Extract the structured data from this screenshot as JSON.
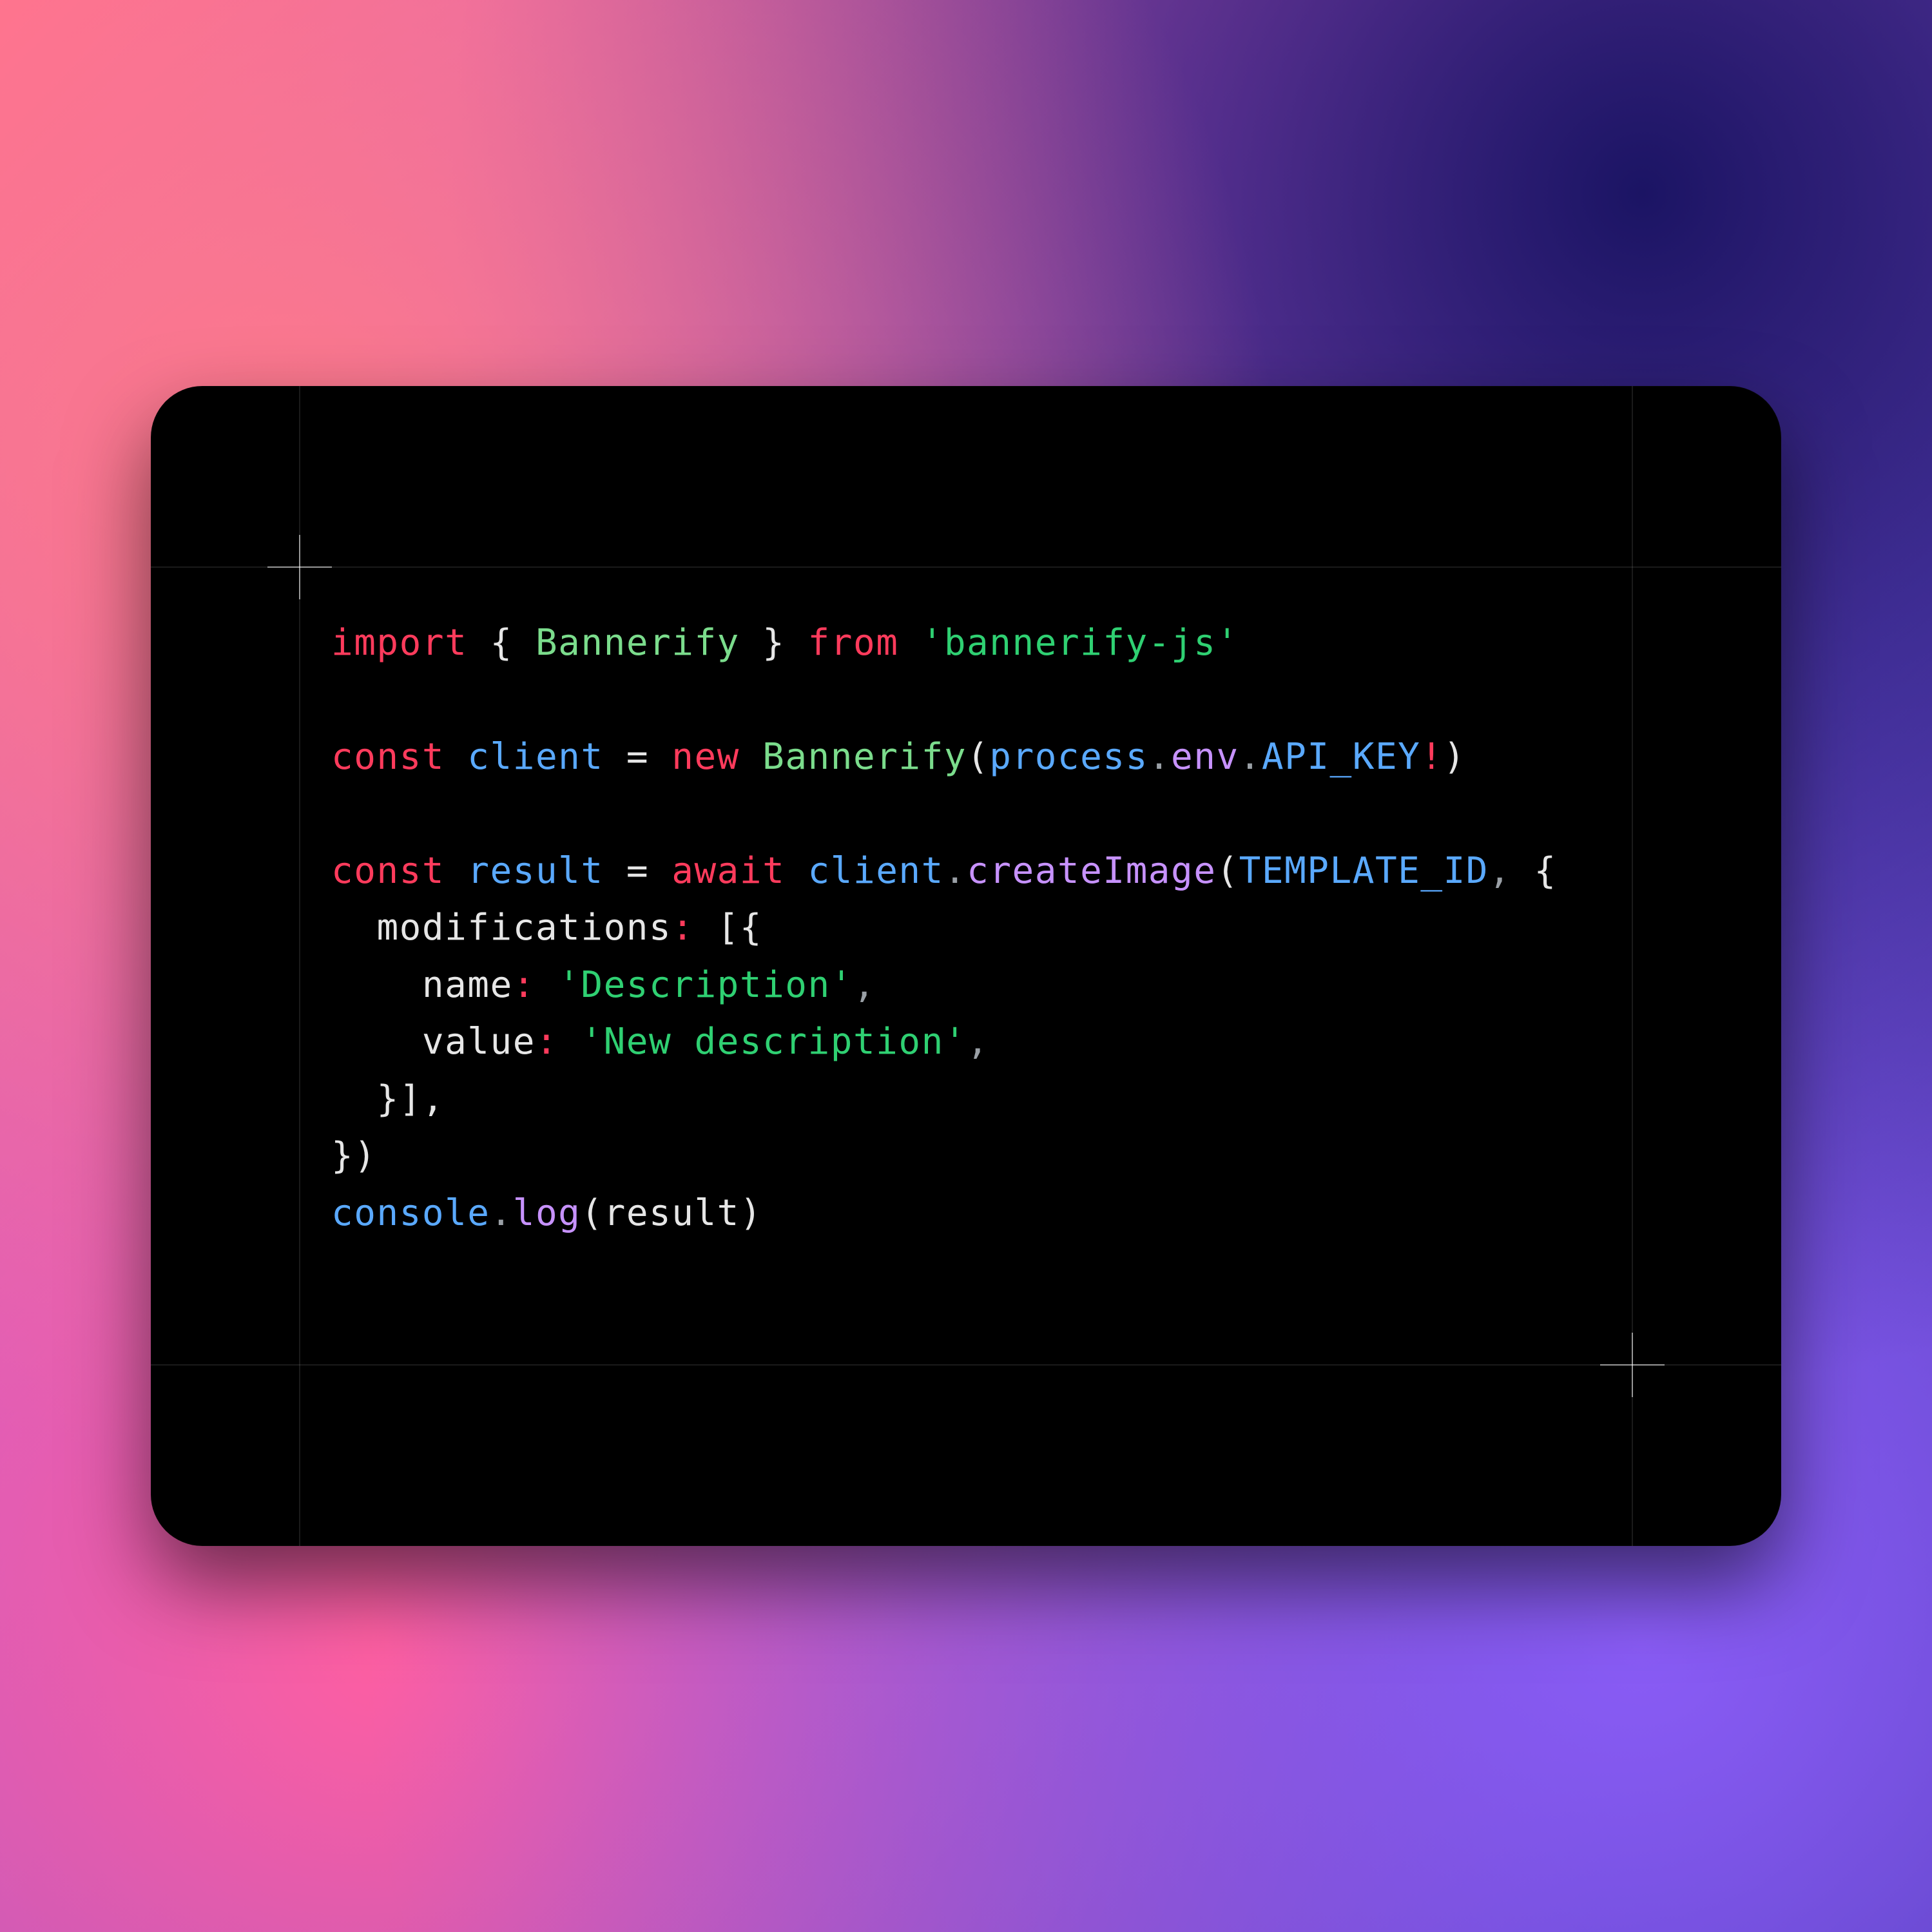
{
  "code": {
    "l1": {
      "import": "import",
      "lb": "{ ",
      "class": "Bannerify",
      "rb": " }",
      "from": "from",
      "pkg": "'bannerify-js'"
    },
    "l3": {
      "const": "const",
      "client": "client",
      "eq": "=",
      "new": "new",
      "class": "Bannerify",
      "lp": "(",
      "process": "process",
      "dot1": ".",
      "env": "env",
      "dot2": ".",
      "apikey": "API_KEY",
      "bang": "!",
      "rp": ")"
    },
    "l5": {
      "const": "const",
      "result": "result",
      "eq": "=",
      "await": "await",
      "client": "client",
      "dot": ".",
      "method": "createImage",
      "lp": "(",
      "tmpl": "TEMPLATE_ID",
      "comma": ",",
      "lb": "{"
    },
    "l6": {
      "indent": "  ",
      "mods": "modifications",
      "colon": ":",
      "arr": "[{"
    },
    "l7": {
      "indent": "    ",
      "name": "name",
      "colon": ":",
      "val": "'Description'",
      "comma": ","
    },
    "l8": {
      "indent": "    ",
      "value": "value",
      "colon": ":",
      "val": "'New description'",
      "comma": ","
    },
    "l9": {
      "indent": "  ",
      "close": "}],"
    },
    "l10": {
      "close": "})"
    },
    "l11": {
      "console": "console",
      "dot": ".",
      "log": "log",
      "lp": "(",
      "result": "result",
      "rp": ")"
    }
  }
}
